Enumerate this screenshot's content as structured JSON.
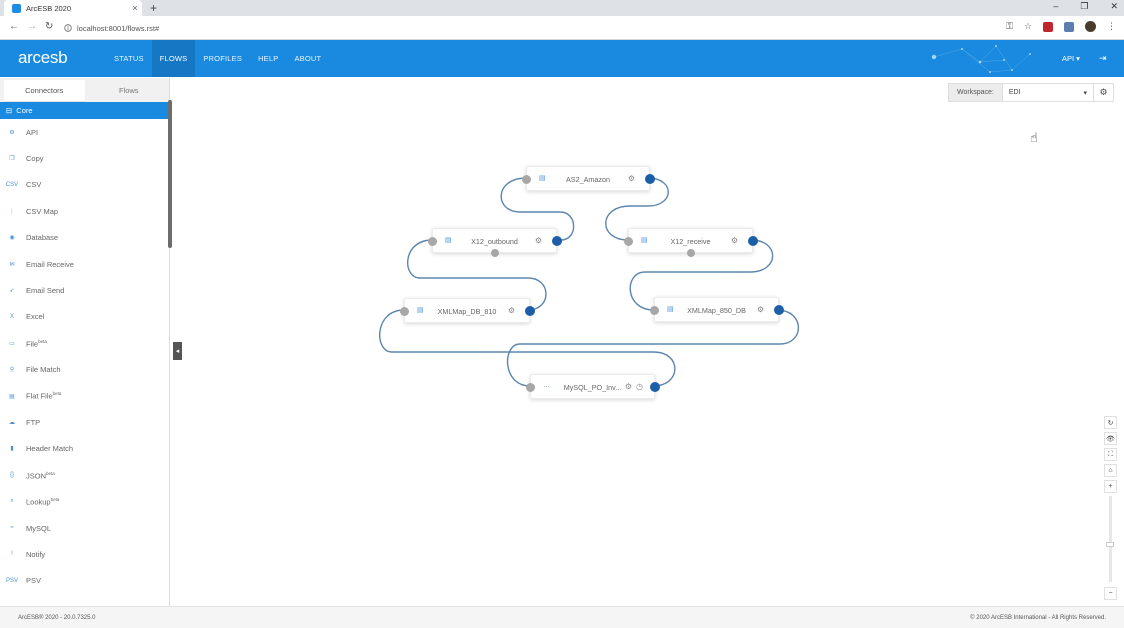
{
  "browser": {
    "tab_title": "ArcESB 2020",
    "tab_close": "×",
    "new_tab": "+",
    "url": "localhost:8001/flows.rst#",
    "window_controls": [
      "–",
      "❐",
      "✕"
    ],
    "nav": {
      "back": "←",
      "forward": "→",
      "reload": "↻"
    }
  },
  "header": {
    "logo": "arcesb",
    "nav": [
      "STATUS",
      "FLOWS",
      "PROFILES",
      "HELP",
      "ABOUT"
    ],
    "active": "FLOWS",
    "api_menu": "API ▾",
    "accent_color": "#1a8ae0"
  },
  "sidebar": {
    "tabs": [
      "Connectors",
      "Flows"
    ],
    "category": "Core",
    "connectors": [
      {
        "label": "API",
        "icon": "api-icon",
        "glyph": "⚙"
      },
      {
        "label": "Copy",
        "icon": "copy-icon",
        "glyph": "❐"
      },
      {
        "label": "CSV",
        "icon": "csv-icon",
        "glyph": "CSV"
      },
      {
        "label": "CSV Map",
        "icon": "csv-map-icon",
        "glyph": "⋮"
      },
      {
        "label": "Database",
        "icon": "database-icon",
        "glyph": "◉"
      },
      {
        "label": "Email Receive",
        "icon": "email-receive-icon",
        "glyph": "✉"
      },
      {
        "label": "Email Send",
        "icon": "email-send-icon",
        "glyph": "➶"
      },
      {
        "label": "Excel",
        "icon": "excel-icon",
        "glyph": "X"
      },
      {
        "label": "File",
        "icon": "file-icon",
        "glyph": "▭",
        "beta": "beta"
      },
      {
        "label": "File Match",
        "icon": "file-match-icon",
        "glyph": "⚲"
      },
      {
        "label": "Flat File",
        "icon": "flat-file-icon",
        "glyph": "▤",
        "beta": "beta"
      },
      {
        "label": "FTP",
        "icon": "ftp-icon",
        "glyph": "☁"
      },
      {
        "label": "Header Match",
        "icon": "header-match-icon",
        "glyph": "▮"
      },
      {
        "label": "JSON",
        "icon": "json-icon",
        "glyph": "{}",
        "beta": "beta"
      },
      {
        "label": "Lookup",
        "icon": "lookup-icon",
        "glyph": "⌕",
        "beta": "beta"
      },
      {
        "label": "MySQL",
        "icon": "mysql-icon",
        "glyph": "≈"
      },
      {
        "label": "Notify",
        "icon": "notify-icon",
        "glyph": "!"
      },
      {
        "label": "PSV",
        "icon": "psv-icon",
        "glyph": "PSV"
      }
    ]
  },
  "workspace": {
    "label": "Workspace:",
    "value": "EDI"
  },
  "flow_nodes": [
    {
      "label": "AS2_Amazon",
      "icon": "as2-icon"
    },
    {
      "label": "X12_outbound",
      "icon": "x12-icon"
    },
    {
      "label": "X12_receive",
      "icon": "x12-icon"
    },
    {
      "label": "XMLMap_DB_810",
      "icon": "xmlmap-icon"
    },
    {
      "label": "XMLMap_850_DB",
      "icon": "xmlmap-icon"
    },
    {
      "label": "MySQL_PO_Inv...",
      "icon": "mysql-icon"
    }
  ],
  "toolbar": [
    "↻",
    "👁",
    "⛶",
    "⌂",
    "+"
  ],
  "zoom_out": "−",
  "footer": {
    "left": "ArcESB® 2020 - 20.0.7325.0",
    "right": "© 2020 ArcESB International - All Rights Reserved."
  }
}
